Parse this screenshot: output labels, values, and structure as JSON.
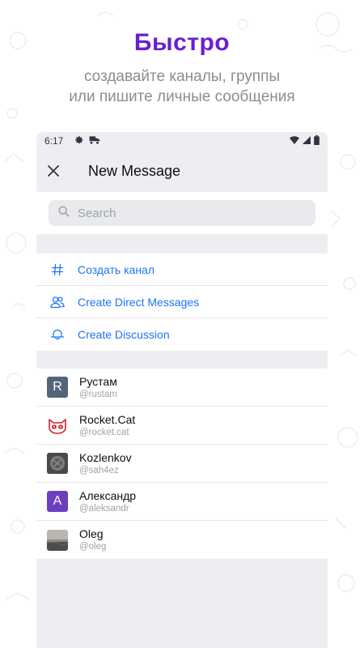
{
  "promo": {
    "title": "Быстро",
    "subtitle_line1": "создавайте каналы, группы",
    "subtitle_line2": "или пишите личные сообщения"
  },
  "statusbar": {
    "time": "6:17",
    "icons": [
      "settings-icon",
      "truck-icon",
      "wifi-icon",
      "signal-icon",
      "battery-icon"
    ]
  },
  "header": {
    "title": "New Message",
    "close_icon": "close-icon"
  },
  "search": {
    "placeholder": "Search",
    "value": ""
  },
  "actions": [
    {
      "label": "Создать канал",
      "icon": "hash-icon"
    },
    {
      "label": "Create Direct Messages",
      "icon": "people-icon"
    },
    {
      "label": "Create Discussion",
      "icon": "discussion-icon"
    }
  ],
  "users": [
    {
      "name": "Рустам",
      "handle": "@rustam",
      "avatar_letter": "R",
      "avatar_color": "#54657a"
    },
    {
      "name": "Rocket.Cat",
      "handle": "@rocket.cat",
      "avatar_letter": "",
      "avatar_color": "#ffffff"
    },
    {
      "name": "Kozlenkov",
      "handle": "@sah4ez",
      "avatar_letter": "",
      "avatar_color": "#5a5a5a"
    },
    {
      "name": "Александр",
      "handle": "@aleksandr",
      "avatar_letter": "A",
      "avatar_color": "#6b3fbf"
    },
    {
      "name": "Oleg",
      "handle": "@oleg",
      "avatar_letter": "",
      "avatar_color": "#7a7f86"
    }
  ],
  "colors": {
    "accent": "#6a1fd1",
    "link": "#1d74f5",
    "surface": "#eeeef2"
  }
}
